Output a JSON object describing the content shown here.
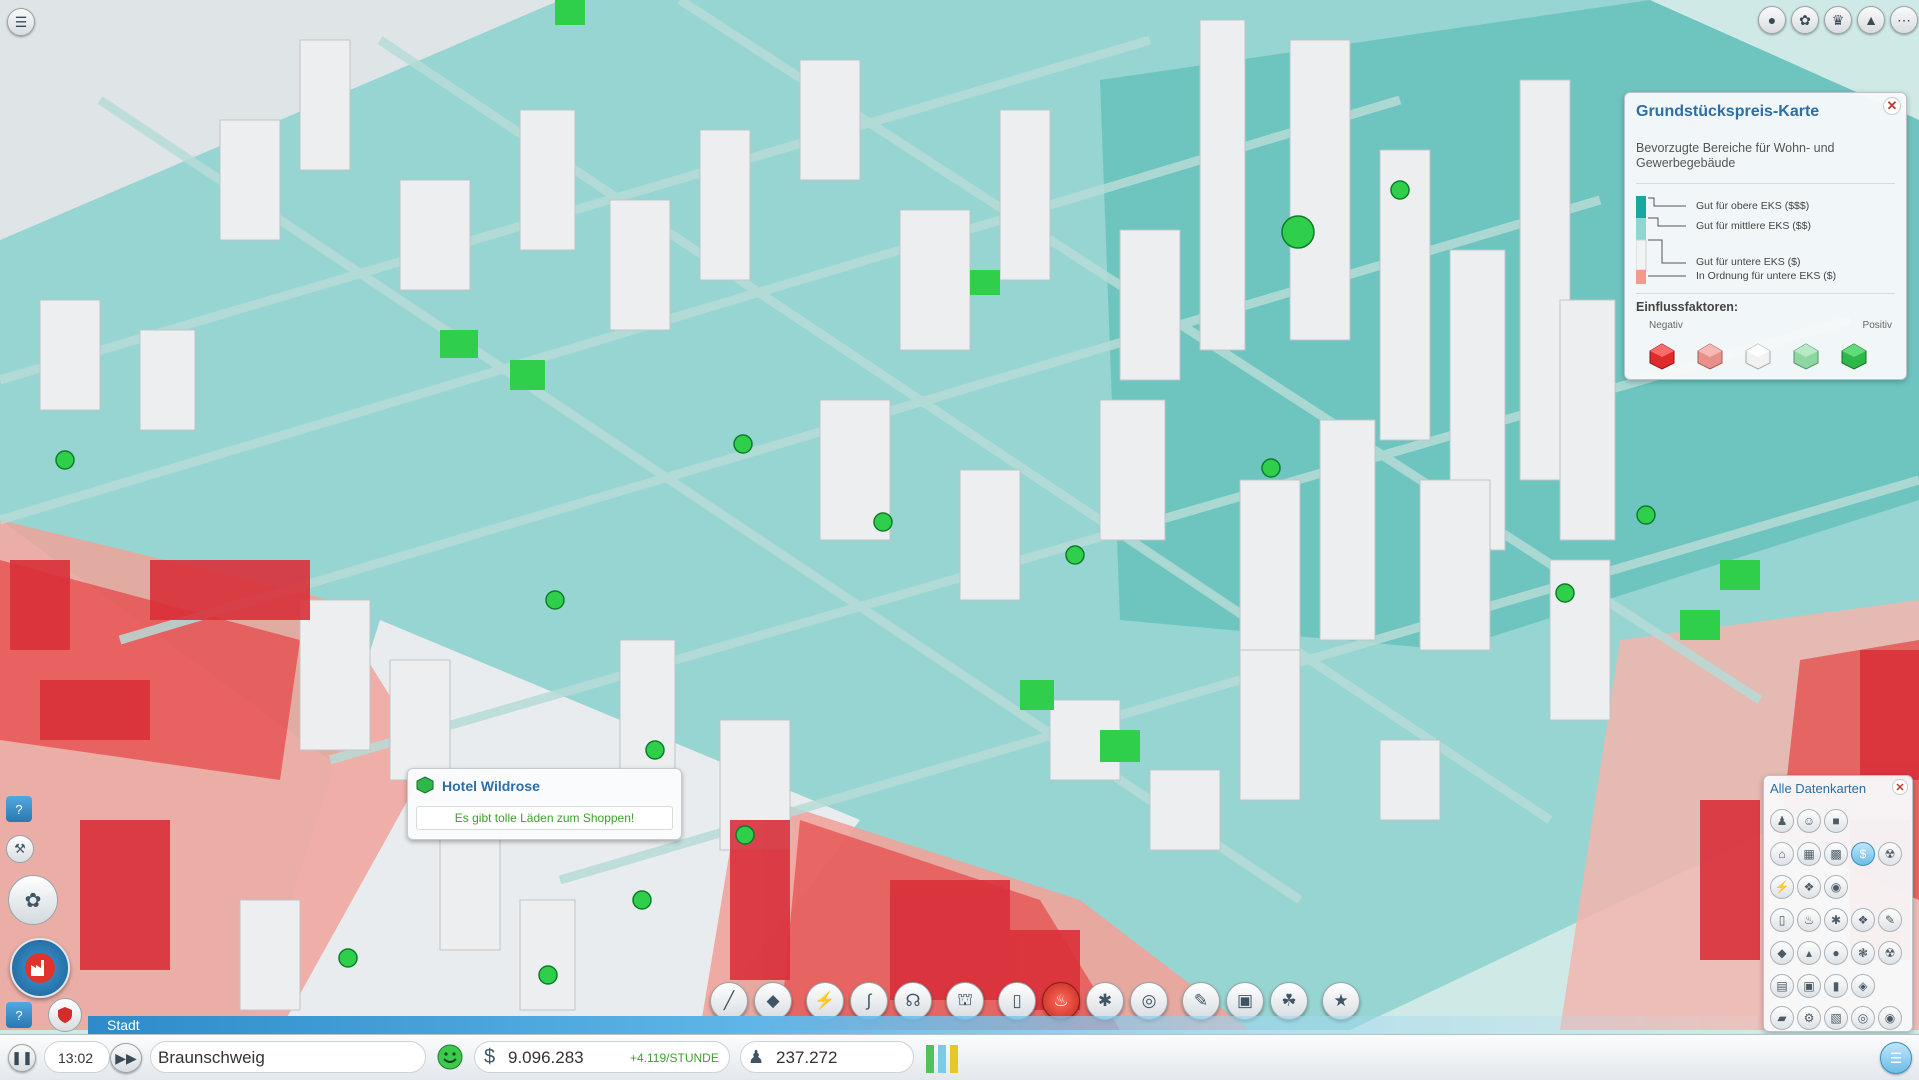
{
  "app": {
    "mode_label": "Stadt",
    "city_name": "Braunschweig",
    "time": "13:02",
    "money": "9.096.283",
    "income": "+4.119/STUNDE",
    "population": "237.272"
  },
  "land_value_panel": {
    "title": "Grundstückspreis-Karte",
    "subtitle": "Bevorzugte Bereiche für Wohn- und Gewerbegebäude",
    "legend": [
      {
        "label": "Gut für obere EKS ($$$)",
        "color": "#1aa6a0"
      },
      {
        "label": "Gut für mittlere EKS ($$)",
        "color": "#8fd6d2"
      },
      {
        "label": "Gut für untere EKS ($)",
        "color": "#f2f4f4"
      },
      {
        "label": "In Ordnung für untere EKS ($)",
        "color": "#f29a8e"
      }
    ],
    "factors_title": "Einflussfaktoren:",
    "negative_label": "Negativ",
    "positive_label": "Positiv",
    "factors": [
      "#e02b2b",
      "#e8908a",
      "#f2f2f2",
      "#8fd7a2",
      "#2fb84a"
    ],
    "close_icon": "close-icon"
  },
  "tooltip": {
    "building_name": "Hotel Wildrose",
    "message": "Es gibt tolle Läden zum Shoppen!"
  },
  "data_maps_panel": {
    "title": "Alle Datenkarten",
    "icons": [
      [
        "citizens-icon",
        "happiness-icon",
        "business-icon"
      ],
      [
        "residential-icon",
        "commercial-icon",
        "industry-icon",
        "land-value-icon",
        "pollution-icon"
      ],
      [
        "power-icon",
        "water-icon",
        "sewage-icon"
      ],
      [
        "garbage-icon",
        "fire-icon",
        "health-icon",
        "crime-icon",
        "education-icon"
      ],
      [
        "coal-icon",
        "ore-icon",
        "oil-icon",
        "wind-icon",
        "radiation-icon"
      ],
      [
        "transit-icon",
        "bus-icon",
        "train-icon",
        "car-icon"
      ],
      [
        "ferry-icon",
        "gear-icon",
        "city-icon",
        "disaster-icon",
        "camera-icon"
      ]
    ]
  },
  "toolbar": [
    "road-tool-icon",
    "zone-tool-icon",
    "power-tool-icon",
    "water-tool-icon",
    "sewage-tool-icon",
    "government-tool-icon",
    "garbage-tool-icon",
    "fire-tool-icon",
    "health-tool-icon",
    "police-tool-icon",
    "education-tool-icon",
    "transport-tool-icon",
    "parks-tool-icon",
    "landmark-tool-icon"
  ],
  "top_right_buttons": [
    "achievements-icon",
    "region-icon",
    "trophy-icon",
    "city-status-icon",
    "more-icon"
  ],
  "colors": {
    "accent": "#2c6ea6",
    "positive": "#3aa12b",
    "teal_area": "#7fcfca",
    "red_area": "#e54848"
  }
}
